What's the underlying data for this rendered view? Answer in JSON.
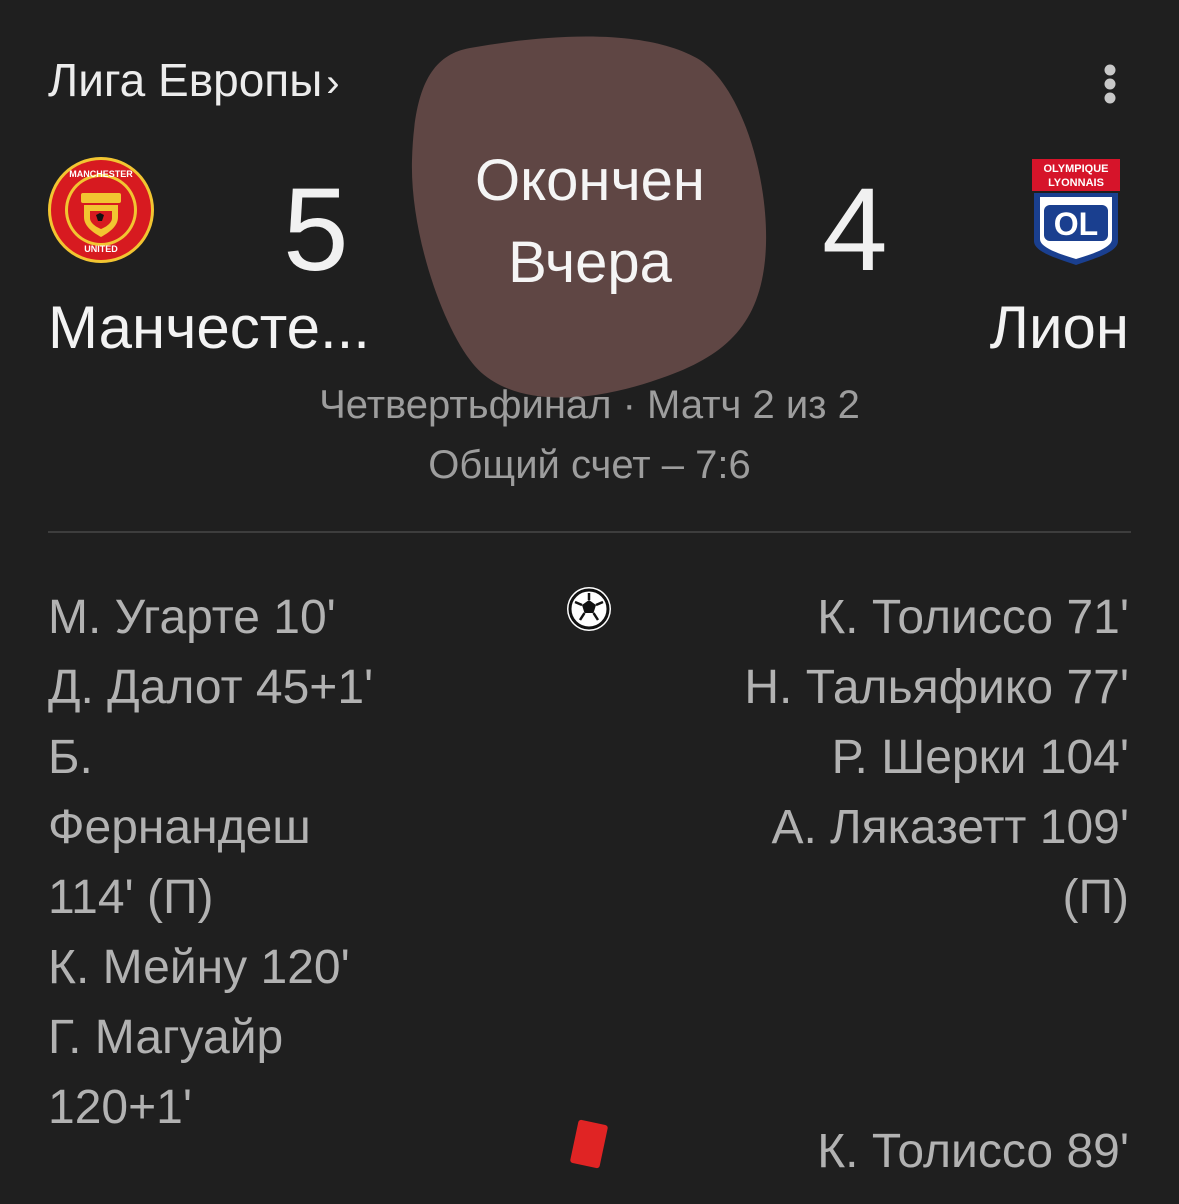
{
  "header": {
    "league": "Лига Европы",
    "league_chevron": "›",
    "menu_icon": "more-vert-icon"
  },
  "match": {
    "status": "Окончен",
    "status_day": "Вчера",
    "status_bg_color": "#5f4644",
    "home": {
      "name": "Манчесте...",
      "score": "5",
      "crest_text_top": "MANCHESTER",
      "crest_text_bottom": "UNITED"
    },
    "away": {
      "name": "Лион",
      "score": "4",
      "crest_text_top": "OLYMPIQUE",
      "crest_text_bottom": "LYONNAIS",
      "crest_letters": "OL"
    },
    "stage": "Четвертьфинал · Матч 2 из 2",
    "aggregate": "Общий счет – 7:6"
  },
  "goals": {
    "icon": "soccer-ball-icon",
    "home": [
      "М. Угарте 10'",
      "Д. Далот 45+1'",
      "Б. Фернандеш 114' (П)",
      "К. Мейну 120'",
      "Г. Магуайр 120+1'"
    ],
    "away": [
      "К. Толиссо 71'",
      "Н. Тальяфико 77'",
      "Р. Шерки 104'",
      "А. Ляказетт 109' (П)"
    ]
  },
  "red_cards": {
    "icon": "red-card-icon",
    "color": "#e02424",
    "away": [
      "К. Толиссо 89'"
    ]
  }
}
